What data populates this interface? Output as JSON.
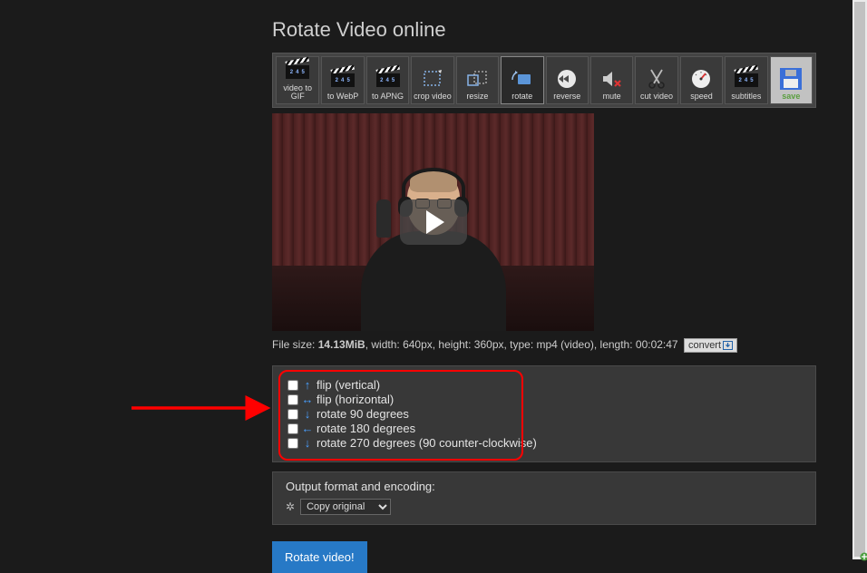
{
  "page_title": "Rotate Video online",
  "toolbar": [
    {
      "id": "video-to-gif",
      "label": "video to GIF"
    },
    {
      "id": "to-webp",
      "label": "to WebP"
    },
    {
      "id": "to-apng",
      "label": "to APNG"
    },
    {
      "id": "crop-video",
      "label": "crop video"
    },
    {
      "id": "resize",
      "label": "resize"
    },
    {
      "id": "rotate",
      "label": "rotate",
      "active": true
    },
    {
      "id": "reverse",
      "label": "reverse"
    },
    {
      "id": "mute",
      "label": "mute"
    },
    {
      "id": "cut-video",
      "label": "cut video"
    },
    {
      "id": "speed",
      "label": "speed"
    },
    {
      "id": "subtitles",
      "label": "subtitles"
    },
    {
      "id": "save",
      "label": "save",
      "save": true
    }
  ],
  "file_info": {
    "prefix": "File size: ",
    "size": "14.13MiB",
    "mid": ", width: 640px, height: 360px, type: mp4 (video), length: 00:02:47",
    "convert_label": "convert"
  },
  "rotate_options": [
    {
      "id": "flip-vertical",
      "label": "flip (vertical)",
      "arrow": "↑",
      "color": "#4aa0ff"
    },
    {
      "id": "flip-horizontal",
      "label": "flip (horizontal)",
      "arrow": "↔",
      "color": "#4aa0ff"
    },
    {
      "id": "rotate-90",
      "label": "rotate 90 degrees",
      "arrow": "↓",
      "color": "#4aa0ff"
    },
    {
      "id": "rotate-180",
      "label": "rotate 180 degrees",
      "arrow": "←",
      "color": "#4aa0ff"
    },
    {
      "id": "rotate-270",
      "label": "rotate 270 degrees (90 counter-clockwise)",
      "arrow": "↓",
      "color": "#4aa0ff"
    }
  ],
  "encoding": {
    "title": "Output format and encoding:",
    "selected": "Copy original"
  },
  "submit_label": "Rotate video!"
}
